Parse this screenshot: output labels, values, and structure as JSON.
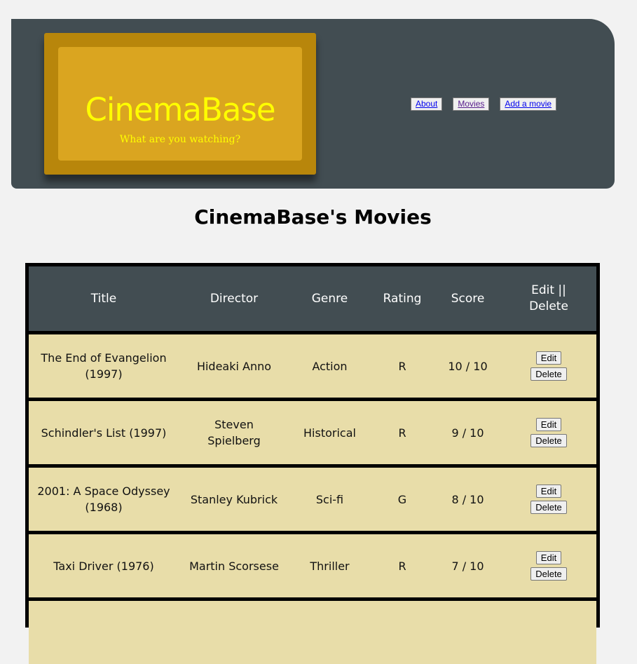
{
  "header": {
    "logo_title": "CinemaBase",
    "logo_tagline": "What are you watching?",
    "nav": [
      {
        "label": "About"
      },
      {
        "label": "Movies"
      },
      {
        "label": "Add a movie"
      }
    ]
  },
  "page_title": "CinemaBase's Movies",
  "table": {
    "columns": [
      "Title",
      "Director",
      "Genre",
      "Rating",
      "Score",
      "Edit || Delete"
    ],
    "rows": [
      {
        "title": "The End of Evangelion (1997)",
        "director": "Hideaki Anno",
        "genre": "Action",
        "rating": "R",
        "score": "10 / 10",
        "edit": "Edit",
        "delete": "Delete"
      },
      {
        "title": "Schindler's List (1997)",
        "director": "Steven Spielberg",
        "genre": "Historical",
        "rating": "R",
        "score": "9 / 10",
        "edit": "Edit",
        "delete": "Delete"
      },
      {
        "title": "2001: A Space Odyssey (1968)",
        "director": "Stanley Kubrick",
        "genre": "Sci-fi",
        "rating": "G",
        "score": "8 / 10",
        "edit": "Edit",
        "delete": "Delete"
      },
      {
        "title": "Taxi Driver (1976)",
        "director": "Martin Scorsese",
        "genre": "Thriller",
        "rating": "R",
        "score": "7 / 10",
        "edit": "Edit",
        "delete": "Delete"
      }
    ]
  },
  "colors": {
    "header_bg": "#424d52",
    "logo_outer": "#b8860b",
    "logo_inner": "#daa520",
    "logo_text": "#ffff00",
    "row_bg": "#e8dda9"
  }
}
